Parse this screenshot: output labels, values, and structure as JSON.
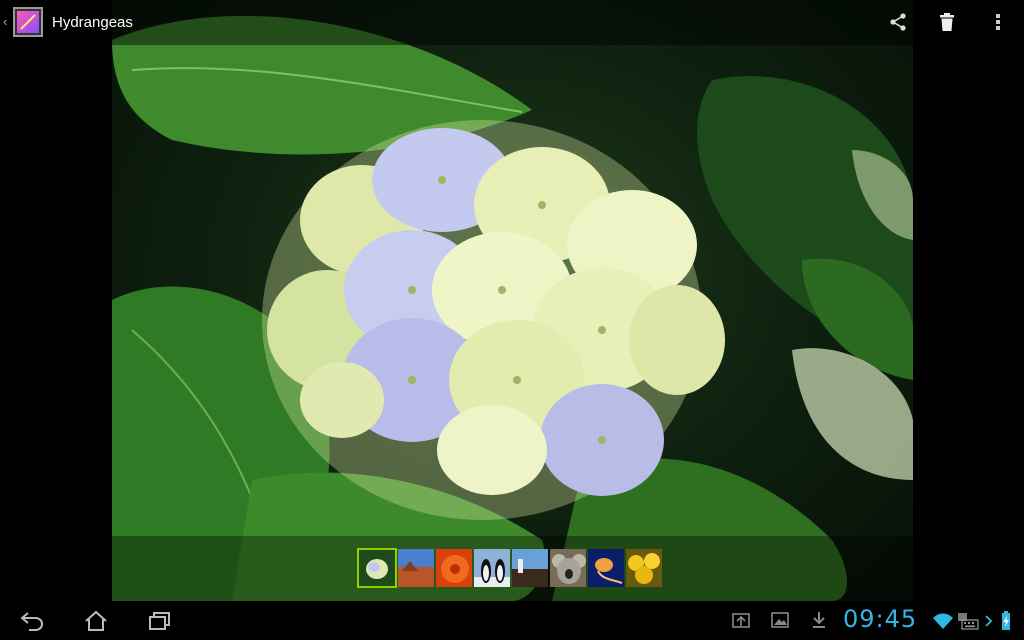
{
  "action_bar": {
    "title": "Hydrangeas",
    "app_icon": "gallery-icon",
    "actions": [
      "share-icon",
      "trash-icon",
      "overflow-menu-icon"
    ]
  },
  "filmstrip": {
    "thumbnails": [
      {
        "subject": "hydrangeas",
        "active": true
      },
      {
        "subject": "desert",
        "active": false
      },
      {
        "subject": "chrysanthemum",
        "active": false
      },
      {
        "subject": "penguins",
        "active": false
      },
      {
        "subject": "lighthouse",
        "active": false
      },
      {
        "subject": "koala",
        "active": false
      },
      {
        "subject": "jellyfish",
        "active": false
      },
      {
        "subject": "tulips",
        "active": false
      }
    ]
  },
  "system_bar": {
    "nav": [
      "back-icon",
      "home-icon",
      "recent-apps-icon"
    ],
    "notifications": [
      "screenshot-icon",
      "gallery-notification-icon",
      "download-icon"
    ],
    "clock": "09:45",
    "status": [
      "wifi-icon",
      "keyboard-icon",
      "charging-battery-icon"
    ],
    "colors": {
      "clock": "#33b5e5",
      "accent": "#8fd000"
    }
  }
}
